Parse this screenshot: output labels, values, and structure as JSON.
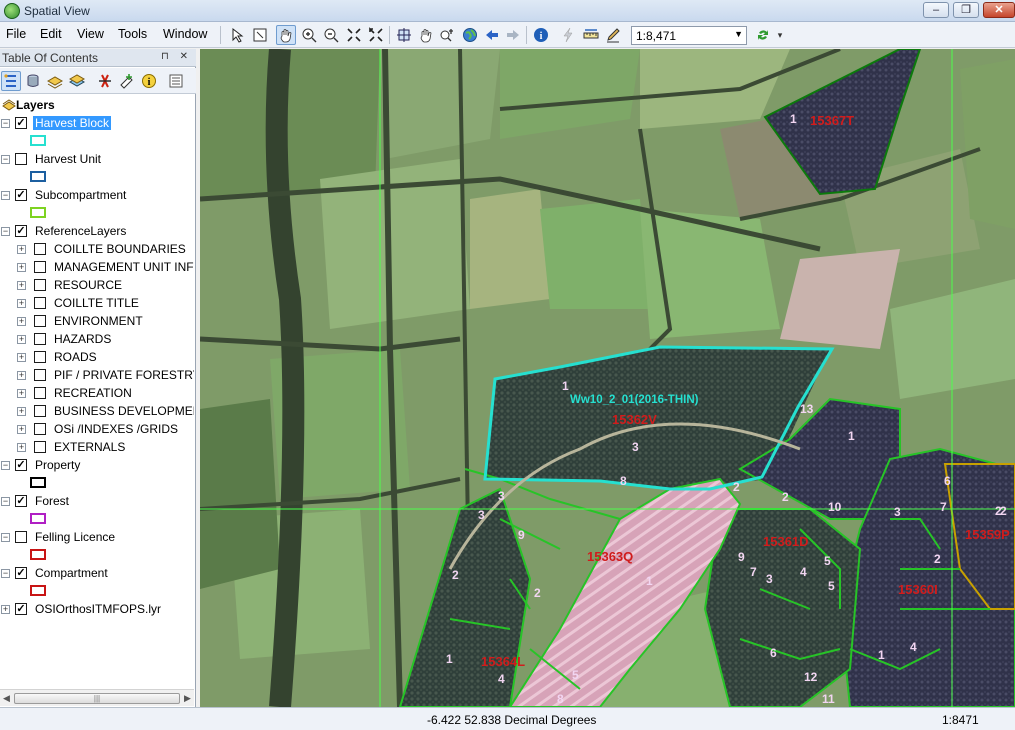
{
  "window": {
    "title": "Spatial View",
    "min_label": "–",
    "max_label": "❐",
    "close_label": "✕"
  },
  "menu": [
    "File",
    "Edit",
    "View",
    "Tools",
    "Window"
  ],
  "toolbar": {
    "scale_value": "1:8,471",
    "tools": [
      "select-elements-icon",
      "identify-frame-icon",
      "pan-icon",
      "zoom-in-icon",
      "zoom-out-icon",
      "fixed-zoom-in-icon",
      "fixed-zoom-out-icon",
      "full-extent-icon",
      "pan-hand-icon",
      "find-icon",
      "globe-icon",
      "back-arrow-icon",
      "forward-arrow-icon",
      "info-icon",
      "lightning-icon",
      "measure-icon",
      "pencil-icon",
      "refresh-icon"
    ]
  },
  "toc": {
    "title": "Table Of Contents",
    "header_icons": "⊓ ✕",
    "root_label": "Layers",
    "layers": [
      {
        "label": "Harvest Block",
        "checked": true,
        "selected": true,
        "expander": "−",
        "swatch": "#26e0d0"
      },
      {
        "label": "Harvest Unit",
        "checked": false,
        "expander": "−",
        "swatch": "#1c5fa0"
      },
      {
        "label": "Subcompartment",
        "checked": true,
        "expander": "−",
        "swatch": "#7ed321"
      },
      {
        "label": "ReferenceLayers",
        "checked": true,
        "expander": "−",
        "children": [
          "COILLTE BOUNDARIES",
          "MANAGEMENT UNIT INFO",
          "RESOURCE",
          "COILLTE TITLE",
          "ENVIRONMENT",
          "HAZARDS",
          "ROADS",
          "PIF / PRIVATE FORESTRY",
          "RECREATION",
          "BUSINESS DEVELOPMENT",
          "OSi /INDEXES /GRIDS",
          "EXTERNALS"
        ]
      },
      {
        "label": "Property",
        "checked": true,
        "expander": "−",
        "swatch": "#000000"
      },
      {
        "label": "Forest",
        "checked": true,
        "expander": "−",
        "swatch": "#b01fc4"
      },
      {
        "label": "Felling Licence",
        "checked": false,
        "expander": "−",
        "swatch": "#c81414"
      },
      {
        "label": "Compartment",
        "checked": true,
        "expander": "−",
        "swatch": "#c81414"
      },
      {
        "label": "OSIOrthosITMFOPS.lyr",
        "checked": true,
        "expander": "+"
      }
    ],
    "scroll_thumb": "|||"
  },
  "map": {
    "block_label": "Ww10_2_01(2016-THIN)",
    "compartment_labels": [
      "15367T",
      "15362V",
      "15363Q",
      "15361D",
      "15359P",
      "15360I",
      "15364L"
    ],
    "sub_numbers": [
      "1",
      "1",
      "3",
      "13",
      "1",
      "8",
      "2",
      "2",
      "10",
      "3",
      "6",
      "7",
      "2",
      "3",
      "3",
      "9",
      "2",
      "1",
      "9",
      "7",
      "3",
      "4",
      "5",
      "5",
      "2",
      "2",
      "1",
      "4",
      "5",
      "8",
      "1",
      "4",
      "6",
      "12",
      "11",
      "2"
    ]
  },
  "status": {
    "coords": "-6.422  52.838 Decimal Degrees",
    "scale": "1:8471"
  }
}
